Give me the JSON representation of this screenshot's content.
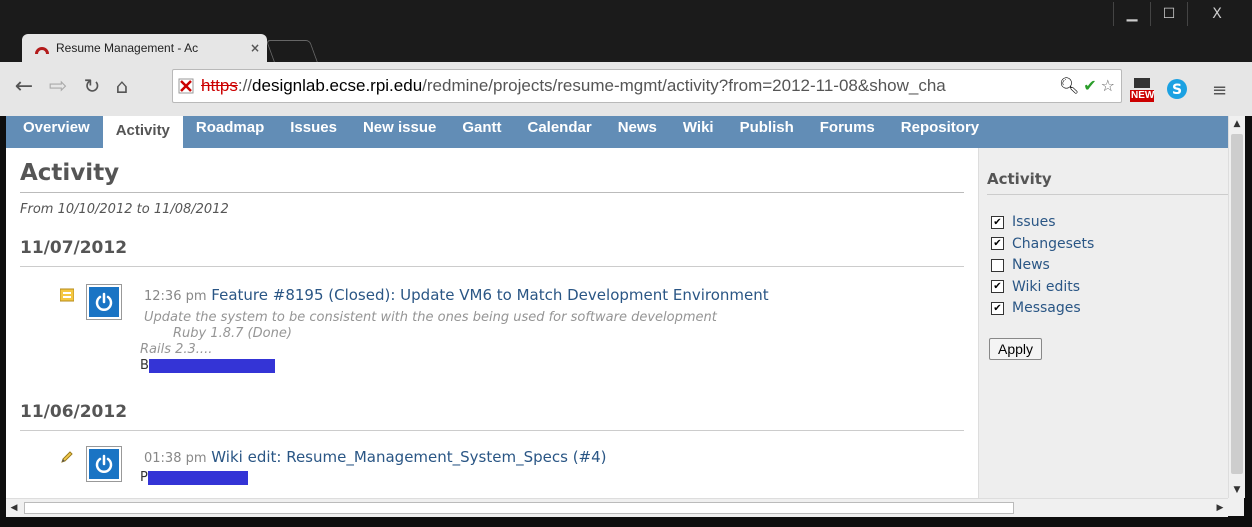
{
  "browser": {
    "tab_title": "Resume Management - Ac",
    "tab_close": "×",
    "url": {
      "scheme": "https",
      "sep": "://",
      "host": "designlab.ecse.rpi.edu",
      "path": "/redmine/projects/resume-mgmt/activity?from=2012-11-08&show_cha"
    },
    "win_minimize": "▁",
    "win_maximize": "☐",
    "win_close": "X",
    "ext_new_label": "NEW"
  },
  "menu": [
    {
      "label": "Overview"
    },
    {
      "label": "Activity",
      "active": true
    },
    {
      "label": "Roadmap"
    },
    {
      "label": "Issues"
    },
    {
      "label": "New issue"
    },
    {
      "label": "Gantt"
    },
    {
      "label": "Calendar"
    },
    {
      "label": "News"
    },
    {
      "label": "Wiki"
    },
    {
      "label": "Publish"
    },
    {
      "label": "Forums"
    },
    {
      "label": "Repository"
    }
  ],
  "page": {
    "title": "Activity",
    "subtitle": "From 10/10/2012 to 11/08/2012",
    "days": [
      {
        "date": "11/07/2012",
        "event": {
          "time": "12:36 pm",
          "link": "Feature #8195 (Closed): Update VM6 to Match Development Environment",
          "desc1": "Update the system to be consistent with the ones being used for software development",
          "desc2": "Ruby 1.8.7 (Done)",
          "desc3": "Rails 2.3....",
          "author_initial": "B"
        }
      },
      {
        "date": "11/06/2012",
        "event": {
          "time": "01:38 pm",
          "link": "Wiki edit: Resume_Management_System_Specs (#4)",
          "author_initial": "P"
        }
      }
    ]
  },
  "sidebar": {
    "title": "Activity",
    "options": [
      {
        "label": "Issues",
        "checked": true
      },
      {
        "label": "Changesets",
        "checked": true
      },
      {
        "label": "News",
        "checked": false
      },
      {
        "label": "Wiki edits",
        "checked": true
      },
      {
        "label": "Messages",
        "checked": true
      }
    ],
    "apply_label": "Apply"
  },
  "colors": {
    "menu_bg": "#628db6",
    "link": "#2a5685",
    "redaction": "#3434d6",
    "avatar": "#1a74c4"
  }
}
